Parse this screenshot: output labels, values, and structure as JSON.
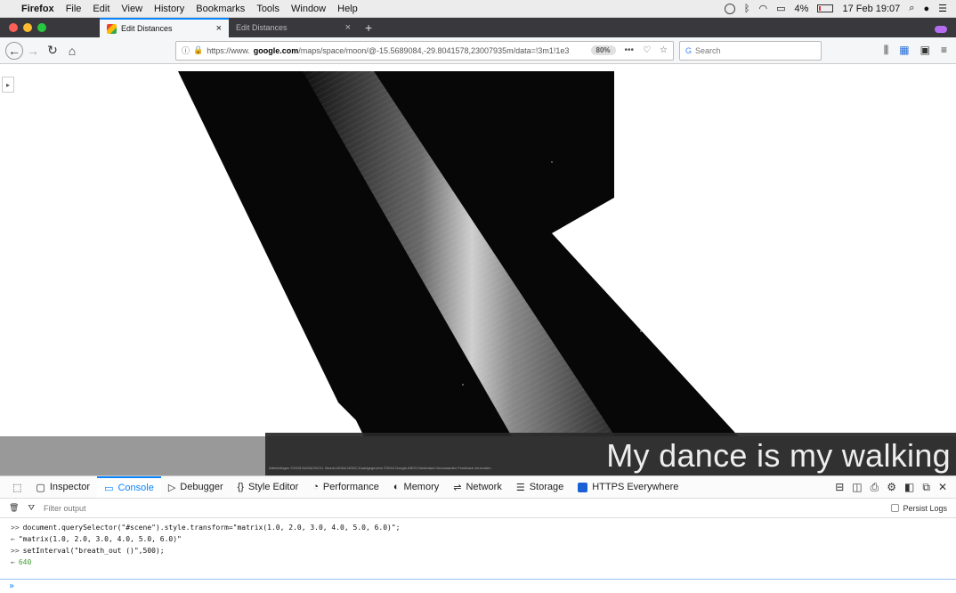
{
  "menubar": {
    "app": "Firefox",
    "menus": [
      "File",
      "Edit",
      "View",
      "History",
      "Bookmarks",
      "Tools",
      "Window",
      "Help"
    ],
    "battery": "4%",
    "datetime": "17 Feb 19:07"
  },
  "tabs": [
    {
      "label": "Edit Distances",
      "active": true
    },
    {
      "label": "Edit Distances",
      "active": false
    }
  ],
  "navbar": {
    "url_prefix": "https://www.",
    "url_host": "google.com",
    "url_path": "/maps/space/moon/@-15.5689084,-29.8041578,23007935m/data=!3m1!1e3",
    "zoom": "80%",
    "search_placeholder": "Search"
  },
  "content": {
    "caption": "My dance is my walking",
    "copyright": "Afbeeldingen ©2018 NASA/JSC/U. Brunei,NOAA NGDC,Kaartgegevens ©2018 Google,INEGI   Nederland   Voorwaarden   Feedback verzenden"
  },
  "devtools": {
    "tabs": [
      "Inspector",
      "Console",
      "Debugger",
      "Style Editor",
      "Performance",
      "Memory",
      "Network",
      "Storage",
      "HTTPS Everywhere"
    ],
    "active_tab": "Console",
    "filter_placeholder": "Filter output",
    "persist_logs": "Persist Logs"
  },
  "console_lines": [
    {
      "prefix": ">>",
      "text": "document.querySelector(\"#scene\").style.transform=\"matrix(1.0, 2.0, 3.0, 4.0, 5.0, 6.0)\";",
      "kind": "input"
    },
    {
      "prefix": "←",
      "text": "\"matrix(1.0, 2.0, 3.0, 4.0, 5.0, 6.0)\"",
      "kind": "output"
    },
    {
      "prefix": ">>",
      "text": "setInterval(\"breath_out ()\",500);",
      "kind": "input"
    },
    {
      "prefix": "←",
      "text": "640",
      "kind": "number"
    }
  ],
  "colors": {
    "accent": "#0a84ff",
    "tabstrip": "#38383d",
    "moon_dark": "#0a0a0a",
    "number_output": "#3f9b2f"
  }
}
